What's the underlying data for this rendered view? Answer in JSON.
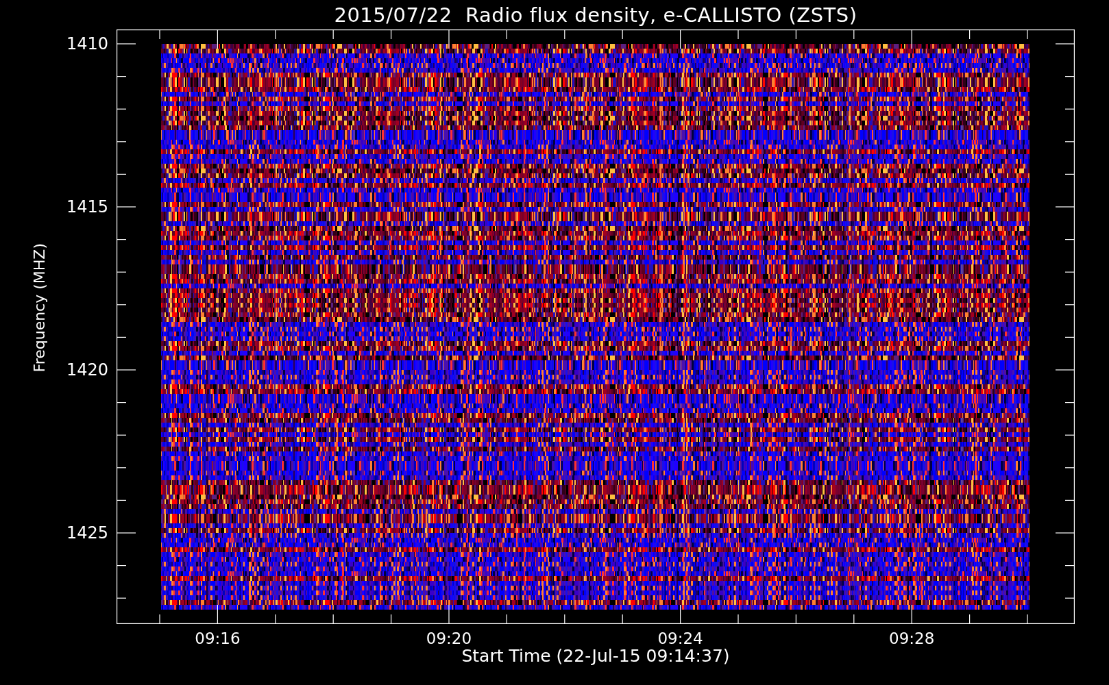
{
  "title": "2015/07/22  Radio flux density, e-CALLISTO (ZSTS)",
  "y_axis": {
    "label": "Frequency (MHZ)",
    "ticks": [
      "1410",
      "1415",
      "1420",
      "1425"
    ]
  },
  "x_axis": {
    "label": "Start Time (22-Jul-15 09:14:37)",
    "ticks": [
      "09:16",
      "09:20",
      "09:24",
      "09:28"
    ]
  }
}
